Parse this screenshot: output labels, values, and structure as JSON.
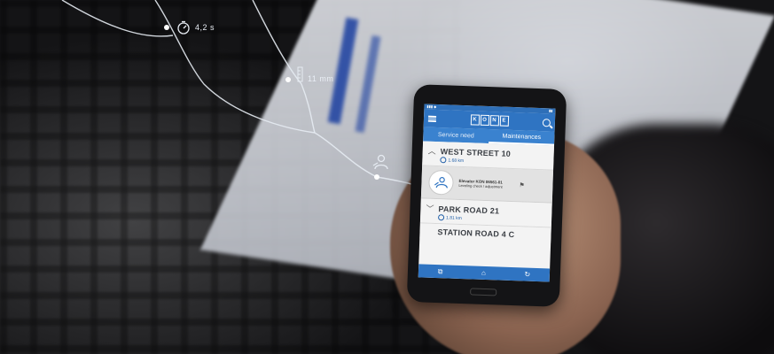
{
  "overlay": {
    "timer_label": "4,2 s",
    "measure_label": "11 mm"
  },
  "phone": {
    "logo_letters": [
      "K",
      "O",
      "N",
      "E"
    ],
    "tabs": [
      {
        "label": "Service need",
        "active": false
      },
      {
        "label": "Maintenances",
        "active": true
      }
    ],
    "sites": [
      {
        "address": "WEST STREET 10",
        "distance": "1.68 km",
        "expanded": true
      },
      {
        "address": "PARK ROAD 21",
        "distance": "1.81 km",
        "expanded": false
      },
      {
        "address": "STATION ROAD 4 C",
        "distance": "",
        "expanded": false
      }
    ],
    "task": {
      "title": "Elevator KON 06561-01",
      "detail": "Leveling check / adjustment"
    },
    "nav_icons": [
      "copy-icon",
      "home-icon",
      "refresh-icon"
    ]
  },
  "colors": {
    "app_blue": "#2f74c2",
    "tab_blue": "#3a82cf",
    "hud_white": "#e9eef5"
  }
}
